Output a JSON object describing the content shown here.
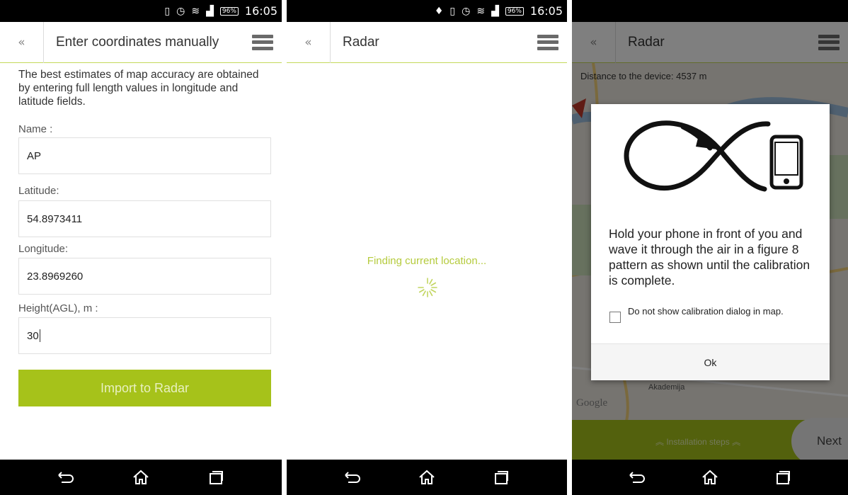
{
  "panel1": {
    "status": {
      "time": "16:05",
      "battery": "96%"
    },
    "title": "Enter coordinates manually",
    "intro": "The best estimates of map accuracy are obtained by entering full length values in longitude and latitude fields.",
    "fields": [
      {
        "label": "Name :",
        "value": "AP"
      },
      {
        "label": "Latitude:",
        "value": "54.8973411"
      },
      {
        "label": "Longitude:",
        "value": "23.8969260"
      },
      {
        "label": "Height(AGL), m :",
        "value": "30"
      }
    ],
    "button": "Import to Radar"
  },
  "panel2": {
    "status": {
      "time": "16:05",
      "battery": "96%"
    },
    "title": "Radar",
    "loading": "Finding current location..."
  },
  "panel3": {
    "title": "Radar",
    "distance": "Distance to the device: 4537 m",
    "map_labels": {
      "academy": "Akademija",
      "google": "Google"
    },
    "install_steps": "Installation steps",
    "next": "Next",
    "dialog": {
      "message": "Hold your phone in front of you and wave it through the air in a figure 8 pattern as shown until the calibration is complete.",
      "checkbox_label": "Do not show calibration dialog in map.",
      "checked": false,
      "ok": "Ok"
    }
  },
  "colors": {
    "accent": "#a6c21a",
    "loading_text": "#b5cb3d"
  },
  "icons": [
    "back-chevrons-icon",
    "menu-icon",
    "nav-back-icon",
    "nav-home-icon",
    "nav-recents-icon",
    "figure-eight-phone-icon",
    "spinner-icon"
  ]
}
